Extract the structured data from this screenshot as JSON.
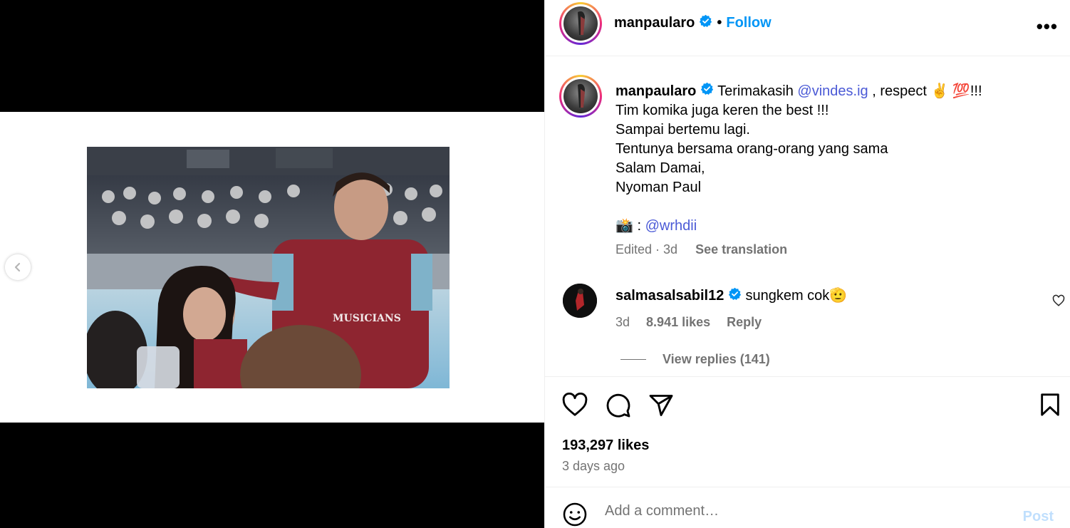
{
  "post": {
    "username": "manpaularo",
    "follow_label": "Follow",
    "dot": "•",
    "more_label": "•••"
  },
  "caption": {
    "username": "manpaularo",
    "prefix": "Terimakasih",
    "mention1": "@vindes.ig",
    "after_mention": ", respect",
    "emojis": "✌️ 💯",
    "exclaim": "!!!",
    "line2": "Tim komika juga keren the best !!!",
    "line3": "Sampai bertemu lagi.",
    "line4": "Tentunya bersama orang-orang yang sama",
    "line5": "Salam Damai,",
    "line6": "Nyoman Paul",
    "camera_emoji": "📸",
    "camera_sep": ":",
    "mention2": "@wrhdii",
    "edited": "Edited · 3d",
    "see_translation": "See translation"
  },
  "comment": {
    "username": "salmasalsabil12",
    "text": "sungkem cok",
    "emoji": "🫡",
    "time": "3d",
    "likes": "8.941 likes",
    "reply": "Reply",
    "view_replies": "View replies (141)"
  },
  "stats": {
    "likes": "193,297 likes",
    "date": "3 days ago"
  },
  "add_comment": {
    "placeholder": "Add a comment…",
    "post_label": "Post"
  },
  "colors": {
    "link": "#0095f6",
    "mention": "#4b5ad6",
    "muted": "#737373",
    "verified": "#0095f6"
  }
}
